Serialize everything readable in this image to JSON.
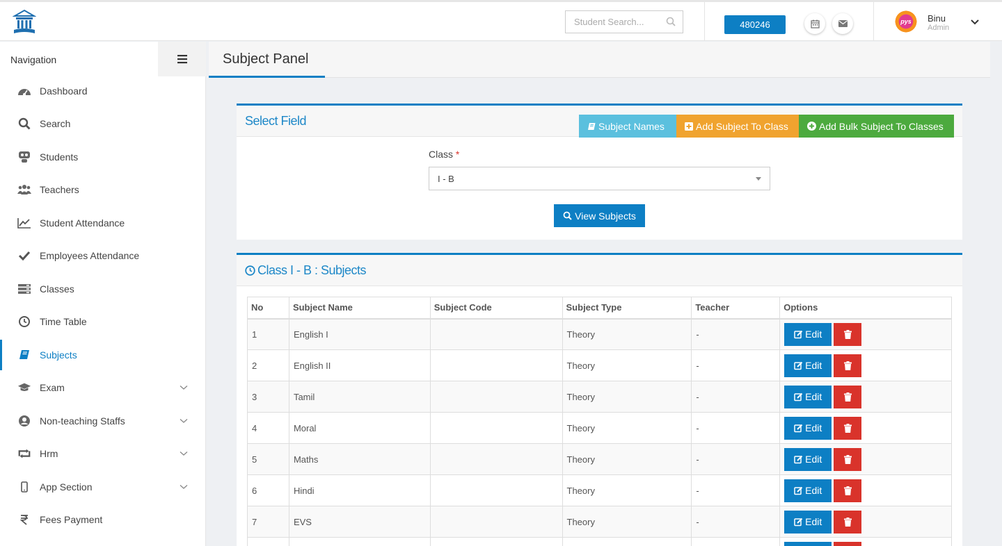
{
  "header": {
    "search_placeholder": "Student Search...",
    "badge_number": "480246",
    "user_name": "Binu",
    "user_role": "Admin",
    "avatar_text": "pys"
  },
  "sidebar": {
    "heading": "Navigation",
    "items": [
      {
        "label": "Dashboard",
        "icon": "dashboard-icon"
      },
      {
        "label": "Search",
        "icon": "search-icon"
      },
      {
        "label": "Students",
        "icon": "students-icon"
      },
      {
        "label": "Teachers",
        "icon": "teachers-icon"
      },
      {
        "label": "Student Attendance",
        "icon": "chart-line-icon"
      },
      {
        "label": "Employees Attendance",
        "icon": "check-icon"
      },
      {
        "label": "Classes",
        "icon": "classes-icon"
      },
      {
        "label": "Time Table",
        "icon": "clock-icon"
      },
      {
        "label": "Subjects",
        "icon": "book-icon",
        "active": true
      },
      {
        "label": "Exam",
        "icon": "graduation-cap-icon",
        "expandable": true
      },
      {
        "label": "Non-teaching Staffs",
        "icon": "user-circle-icon",
        "expandable": true
      },
      {
        "label": "Hrm",
        "icon": "retweet-icon",
        "expandable": true
      },
      {
        "label": "App Section",
        "icon": "mobile-icon",
        "expandable": true
      },
      {
        "label": "Fees Payment",
        "icon": "rupee-icon"
      }
    ]
  },
  "page": {
    "title": "Subject Panel"
  },
  "select_panel": {
    "title": "Select Field",
    "buttons": {
      "subject_names": "Subject Names",
      "add_subject": "Add Subject To Class",
      "add_bulk": "Add Bulk Subject To Classes"
    },
    "class_label": "Class",
    "required_mark": "*",
    "class_value": "I - B",
    "view_button": "View Subjects"
  },
  "subjects_panel": {
    "title": "Class I - B : Subjects",
    "columns": [
      "No",
      "Subject Name",
      "Subject Code",
      "Subject Type",
      "Teacher",
      "Options"
    ],
    "edit_label": "Edit",
    "rows": [
      {
        "no": "1",
        "name": "English I",
        "code": "",
        "type": "Theory",
        "teacher": "-"
      },
      {
        "no": "2",
        "name": "English II",
        "code": "",
        "type": "Theory",
        "teacher": "-"
      },
      {
        "no": "3",
        "name": "Tamil",
        "code": "",
        "type": "Theory",
        "teacher": "-"
      },
      {
        "no": "4",
        "name": "Moral",
        "code": "",
        "type": "Theory",
        "teacher": "-"
      },
      {
        "no": "5",
        "name": "Maths",
        "code": "",
        "type": "Theory",
        "teacher": "-"
      },
      {
        "no": "6",
        "name": "Hindi",
        "code": "",
        "type": "Theory",
        "teacher": "-"
      },
      {
        "no": "7",
        "name": "EVS",
        "code": "",
        "type": "Theory",
        "teacher": "-"
      },
      {
        "no": "",
        "name": "",
        "code": "",
        "type": "",
        "teacher": ""
      }
    ]
  },
  "colors": {
    "primary": "#0d7fc4",
    "info": "#5bc0de",
    "warning": "#f0a32f",
    "success": "#4caa3e",
    "danger": "#d9332b"
  }
}
